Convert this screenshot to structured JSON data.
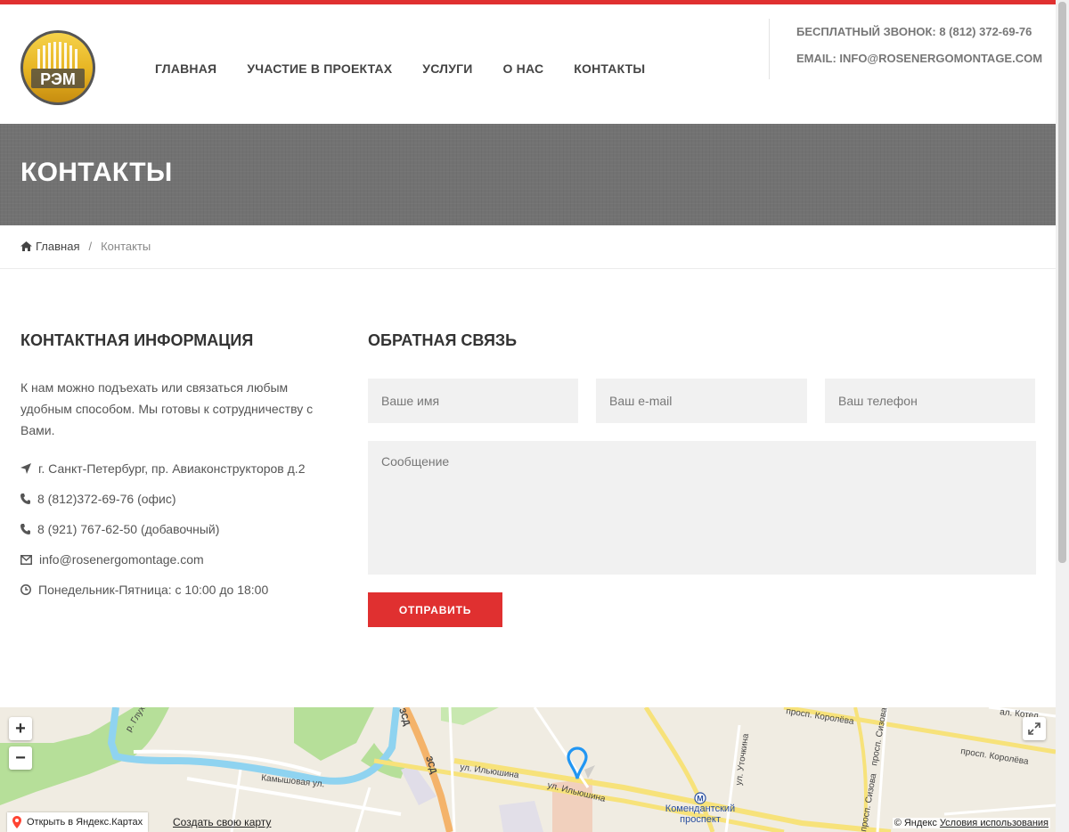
{
  "header": {
    "logo_text": "РЭМ",
    "nav": [
      {
        "label": "ГЛАВНАЯ"
      },
      {
        "label": "УЧАСТИЕ В ПРОЕКТАХ"
      },
      {
        "label": "УСЛУГИ"
      },
      {
        "label": "О НАС"
      },
      {
        "label": "КОНТАКТЫ"
      }
    ],
    "phone_line": "БЕСПЛАТНЫЙ ЗВОНОК: 8 (812) 372-69-76",
    "email_line": "EMAIL: INFO@ROSENERGOMONTAGE.COM"
  },
  "banner": {
    "title": "КОНТАКТЫ"
  },
  "breadcrumb": {
    "home": "Главная",
    "separator": "/",
    "current": "Контакты"
  },
  "contact_info": {
    "heading": "КОНТАКТНАЯ ИНФОРМАЦИЯ",
    "intro": "К нам можно подъехать или связаться любым удобным способом. Мы готовы к сотрудничеству с Вами.",
    "address": "г. Санкт-Петербург, пр. Авиаконструкторов д.2",
    "phone_office": "8 (812)372-69-76 (офис)",
    "phone_extra": "8 (921) 767-62-50 (добавочный)",
    "email": "info@rosenergomontage.com",
    "hours": "Понедельник-Пятница: с 10:00 до 18:00"
  },
  "feedback": {
    "heading": "ОБРАТНАЯ СВЯЗЬ",
    "name_placeholder": "Ваше имя",
    "email_placeholder": "Ваш e-mail",
    "phone_placeholder": "Ваш телефон",
    "message_placeholder": "Сообщение",
    "submit_label": "ОТПРАВИТЬ"
  },
  "map": {
    "zoom_in": "+",
    "zoom_out": "−",
    "open_label": "Открыть в Яндекс.Картах",
    "create_label": "Создать свою карту",
    "copyright": "© Яндекс",
    "terms": "Условия использования",
    "labels": {
      "river": "р. Глух.",
      "kamyshovaya": "Камышовая ул.",
      "ilyushina1": "ул. Ильюшина",
      "ilyushina2": "ул. Ильюшина",
      "zsd1": "ЗСД",
      "zsd2": "ЗСД",
      "koroleva1": "просп. Королёва",
      "koroleva2": "просп. Королёва",
      "sizova1": "просп. Сизова",
      "sizova2": "просп. Сизова",
      "utochkina": "ул. Уточкина",
      "kotel": "ал. Котел.",
      "metro_letter": "М",
      "metro_name1": "Комендантский",
      "metro_name2": "проспект"
    },
    "colors": {
      "land": "#f0ece2",
      "park": "#b6df99",
      "water": "#8fd3f0",
      "highway": "#f4b36a",
      "road": "#f7e27a",
      "pin": "#2196f3"
    }
  },
  "colors": {
    "accent": "#e03030",
    "banner": "#727272"
  }
}
